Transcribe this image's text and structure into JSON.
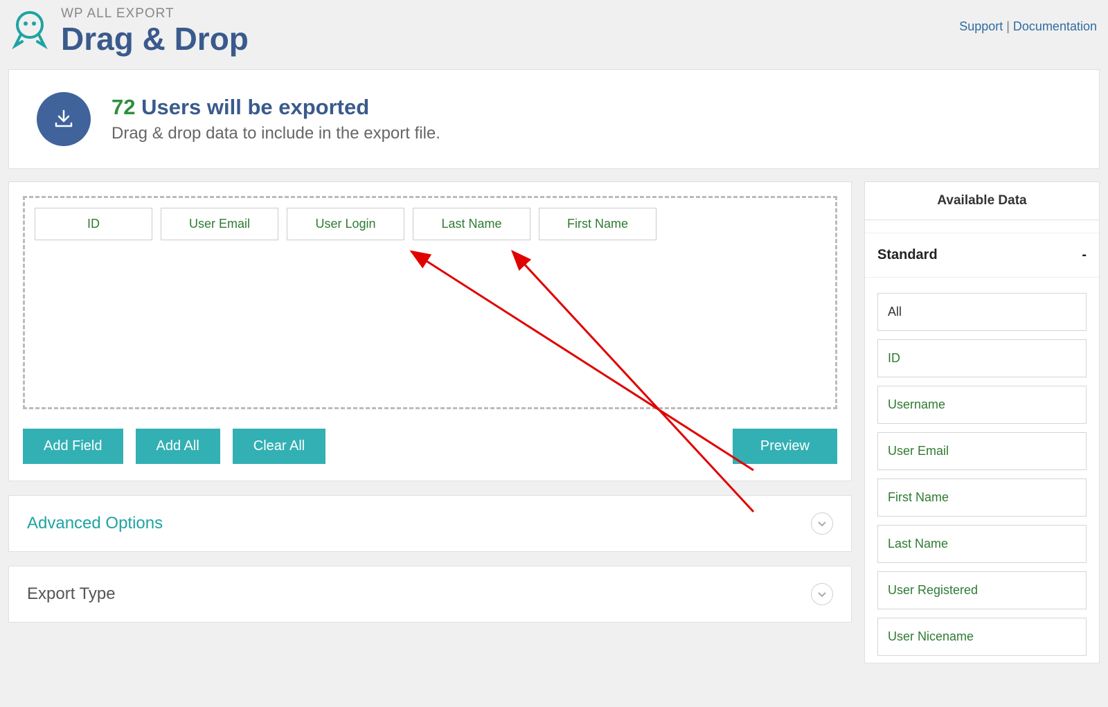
{
  "header": {
    "brand_sup": "WP ALL EXPORT",
    "brand_title": "Drag & Drop",
    "links": {
      "support": "Support",
      "separator": " | ",
      "docs": "Documentation"
    }
  },
  "summary": {
    "count": "72",
    "headline_rest": " Users will be exported",
    "subtext": "Drag & drop data to include in the export file."
  },
  "drop_fields": [
    "ID",
    "User Email",
    "User Login",
    "Last Name",
    "First Name"
  ],
  "buttons": {
    "add_field": "Add Field",
    "add_all": "Add All",
    "clear_all": "Clear All",
    "preview": "Preview"
  },
  "sections": {
    "advanced": "Advanced Options",
    "export_type": "Export Type"
  },
  "sidebar": {
    "title": "Available Data",
    "group": "Standard",
    "group_toggle": "-",
    "items": [
      {
        "label": "All",
        "style": "black"
      },
      {
        "label": "ID",
        "style": "green"
      },
      {
        "label": "Username",
        "style": "green"
      },
      {
        "label": "User Email",
        "style": "green"
      },
      {
        "label": "First Name",
        "style": "green"
      },
      {
        "label": "Last Name",
        "style": "green"
      },
      {
        "label": "User Registered",
        "style": "green"
      },
      {
        "label": "User Nicename",
        "style": "green"
      }
    ]
  },
  "annotations": {
    "arrows": [
      {
        "from_item_index": 4,
        "to_field_index": 3
      },
      {
        "from_item_index": 5,
        "to_field_index": 4
      }
    ]
  }
}
